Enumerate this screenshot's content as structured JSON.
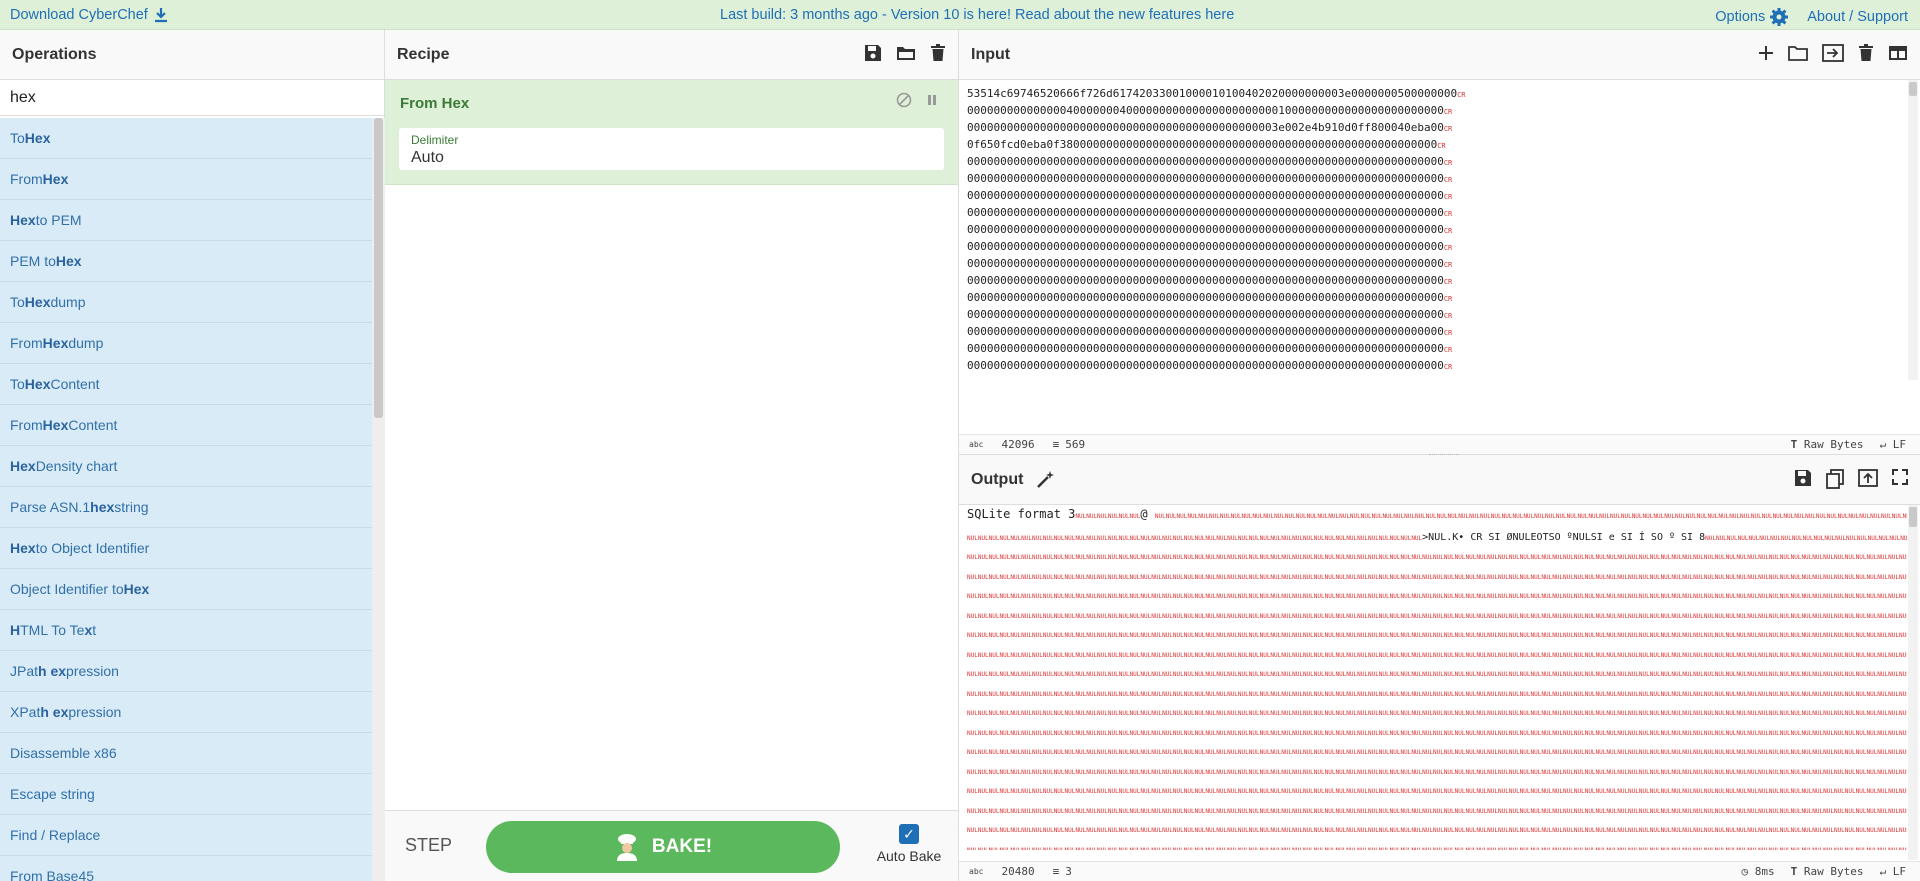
{
  "banner": {
    "download_label": "Download CyberChef",
    "build_text": "Last build: 3 months ago - Version 10 is here! Read about the new features here",
    "options_label": "Options",
    "about_label": "About / Support"
  },
  "operations": {
    "title": "Operations",
    "search_value": "hex",
    "items": [
      {
        "pre": "To ",
        "bold": "Hex",
        "post": ""
      },
      {
        "pre": "From ",
        "bold": "Hex",
        "post": ""
      },
      {
        "pre": "",
        "bold": "Hex",
        "post": " to PEM"
      },
      {
        "pre": "PEM to ",
        "bold": "Hex",
        "post": ""
      },
      {
        "pre": "To ",
        "bold": "Hex",
        "post": "dump"
      },
      {
        "pre": "From ",
        "bold": "Hex",
        "post": "dump"
      },
      {
        "pre": "To ",
        "bold": "Hex",
        "post": " Content"
      },
      {
        "pre": "From ",
        "bold": "Hex",
        "post": " Content"
      },
      {
        "pre": "",
        "bold": "Hex",
        "post": " Density chart"
      },
      {
        "pre": "Parse ASN.1 ",
        "bold": "hex",
        "post": " string"
      },
      {
        "pre": "",
        "bold": "Hex",
        "post": " to Object Identifier"
      },
      {
        "pre": "Object Identifier to ",
        "bold": "Hex",
        "post": ""
      },
      {
        "pre": "",
        "bold": "H",
        "post": "TML To Te",
        "bold2": "x",
        "post2": "t"
      },
      {
        "pre": "JPat",
        "bold": "h ex",
        "post": "pression"
      },
      {
        "pre": "XPat",
        "bold": "h ex",
        "post": "pression"
      },
      {
        "pre": "Disassemble x86",
        "bold": "",
        "post": ""
      },
      {
        "pre": "Escape string",
        "bold": "",
        "post": ""
      },
      {
        "pre": "Find / Replace",
        "bold": "",
        "post": ""
      },
      {
        "pre": "From Base45",
        "bold": "",
        "post": ""
      }
    ]
  },
  "recipe": {
    "title": "Recipe",
    "op_name": "From Hex",
    "arg_label": "Delimiter",
    "arg_value": "Auto",
    "step_label": "STEP",
    "bake_label": "BAKE!",
    "auto_bake_label": "Auto Bake"
  },
  "input": {
    "title": "Input",
    "lines": [
      "53514c69746520666f726d61742033001000010100402020000000003e0000000500000000",
      "000000000000000400000004000000000000000000000001000000000000000000000000",
      "00000000000000000000000000000000000000000000003e002e4b910d0ff800040eba00",
      "0f650fcd0eba0f380000000000000000000000000000000000000000000000000000000",
      "000000000000000000000000000000000000000000000000000000000000000000000000",
      "000000000000000000000000000000000000000000000000000000000000000000000000",
      "000000000000000000000000000000000000000000000000000000000000000000000000",
      "000000000000000000000000000000000000000000000000000000000000000000000000",
      "000000000000000000000000000000000000000000000000000000000000000000000000",
      "000000000000000000000000000000000000000000000000000000000000000000000000",
      "000000000000000000000000000000000000000000000000000000000000000000000000",
      "000000000000000000000000000000000000000000000000000000000000000000000000",
      "000000000000000000000000000000000000000000000000000000000000000000000000",
      "000000000000000000000000000000000000000000000000000000000000000000000000",
      "000000000000000000000000000000000000000000000000000000000000000000000000",
      "000000000000000000000000000000000000000000000000000000000000000000000000",
      "000000000000000000000000000000000000000000000000000000000000000000000000",
      "000000000000000000000000000000000000000000000000000000000000000000000000"
    ],
    "line_end_marker": "CR",
    "char_count": "42096",
    "line_count": "569",
    "encoding": "Raw Bytes",
    "eol": "LF"
  },
  "output": {
    "title": "Output",
    "first_line": "SQLite format 3",
    "first_line_tail": "@",
    "second_line_text": ">NUL.K• CR SI ØNULEOTSO ºNULSI e SI Í SO º SI 8",
    "null_fill": "NUL",
    "char_count": "20480",
    "line_count": "3",
    "time": "8ms",
    "encoding": "Raw Bytes",
    "eol": "LF"
  }
}
